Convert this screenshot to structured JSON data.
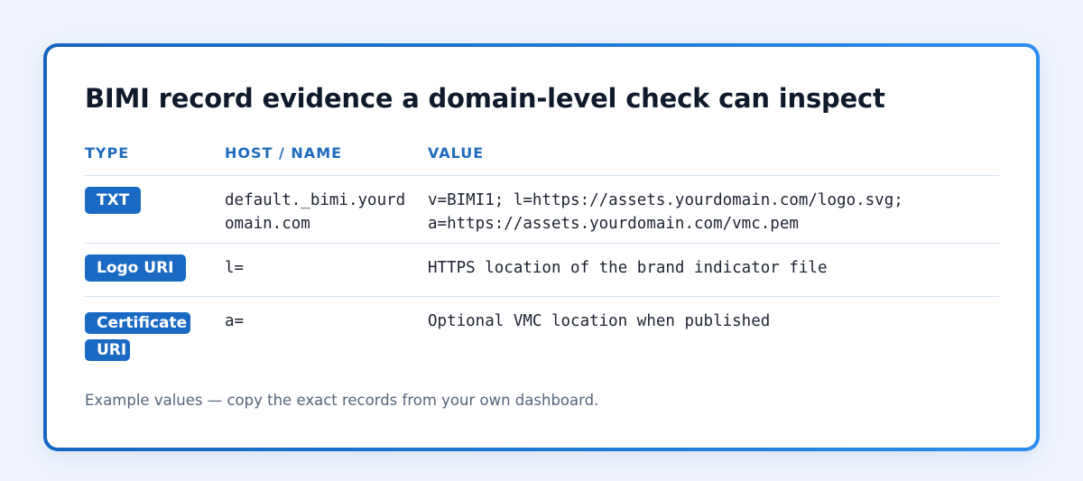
{
  "title": "BIMI record evidence a domain-level check can inspect",
  "table": {
    "headers": [
      "TYPE",
      "HOST / NAME",
      "VALUE"
    ],
    "rows": [
      {
        "type": "TXT",
        "host": "default._bimi.yourdomain.com",
        "value": "v=BIMI1; l=https://assets.yourdomain.com/logo.svg;\na=https://assets.yourdomain.com/vmc.pem"
      },
      {
        "type": "Logo URI",
        "host": "l=",
        "value": "HTTPS location of the brand indicator file"
      },
      {
        "type": "Certificate URI",
        "host": "a=",
        "value": "Optional VMC location when published"
      }
    ]
  },
  "footnote": "Example values — copy the exact records from your own dashboard.",
  "colors": {
    "accent": "#1a6ac4",
    "header_text": "#1e6bbd",
    "border_gradient_start": "#1565c0",
    "border_gradient_end": "#2b8ef0"
  }
}
